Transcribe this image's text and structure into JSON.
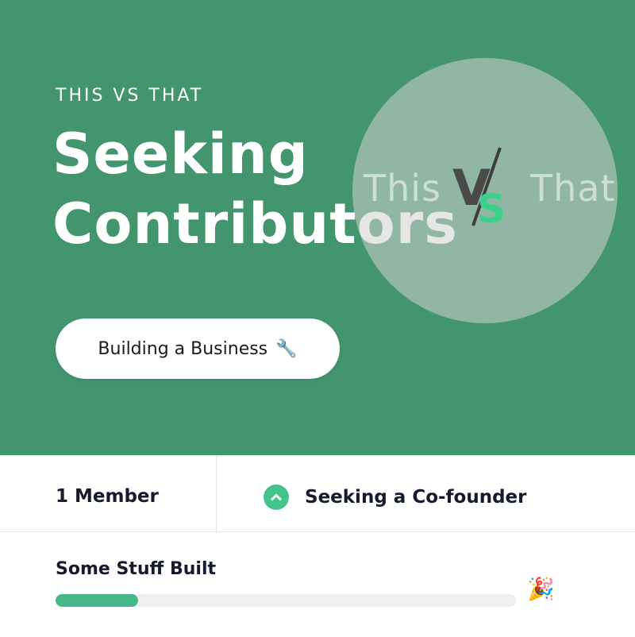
{
  "hero": {
    "eyebrow": "THIS VS THAT",
    "title": "Seeking Contributors",
    "background_color": "#43956e",
    "logo": {
      "left_text": "This",
      "right_text": "That",
      "vs_v": "V",
      "vs_s": "S",
      "accent_color": "#3ad28a"
    },
    "stage_button": {
      "label": "Building a Business",
      "icon": "wrench-icon",
      "icon_glyph": "🔧"
    }
  },
  "stats": {
    "members": "1 Member",
    "seeking": {
      "label": "Seeking a Co-founder",
      "icon": "chevron-up-icon"
    }
  },
  "progress": {
    "label": "Some Stuff Built",
    "value": 0.18,
    "fill_color": "#44b987",
    "icon": "party-popper-icon",
    "icon_glyph": "🎉"
  }
}
